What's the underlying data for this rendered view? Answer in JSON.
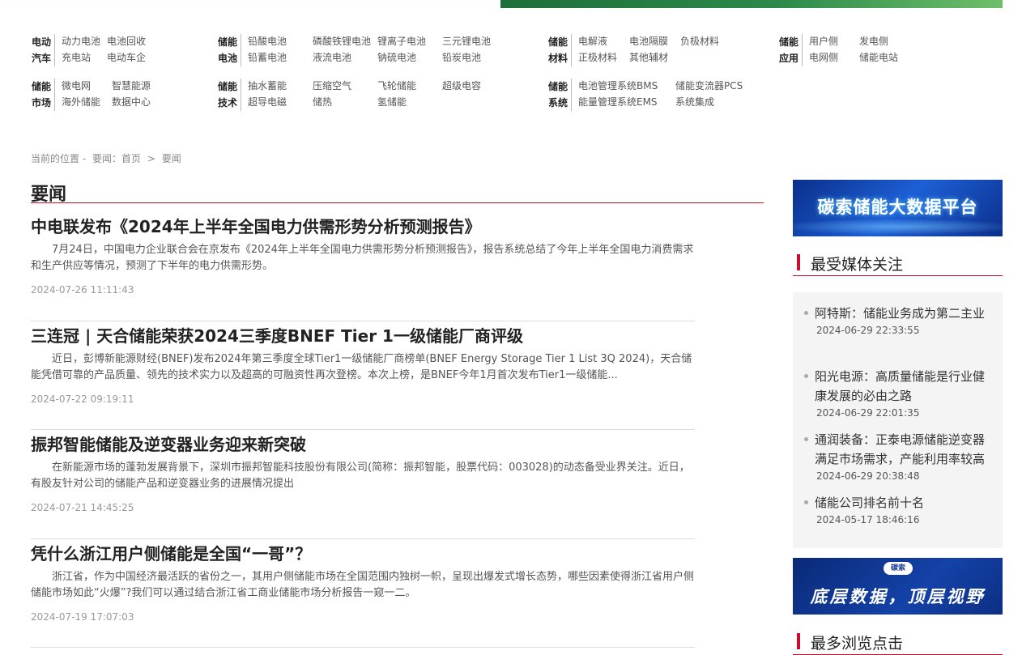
{
  "nav": {
    "groups": [
      {
        "cat": [
          "电动",
          "汽车"
        ],
        "rows": [
          [
            "动力电池",
            "电池回收"
          ],
          [
            "充电站",
            "电动车企"
          ]
        ]
      },
      {
        "cat": [
          "储能",
          "电池"
        ],
        "rows": [
          [
            "铅酸电池",
            "磷酸铁锂电池",
            "锂离子电池",
            "三元锂电池"
          ],
          [
            "铅蓄电池",
            "液流电池",
            "钠硫电池",
            "铅炭电池"
          ]
        ]
      },
      {
        "cat": [
          "储能",
          "材料"
        ],
        "rows": [
          [
            "电解液",
            "电池隔膜",
            "负极材料"
          ],
          [
            "正极材料",
            "其他辅材"
          ]
        ]
      },
      {
        "cat": [
          "储能",
          "应用"
        ],
        "rows": [
          [
            "用户侧",
            "发电侧"
          ],
          [
            "电网侧",
            "储能电站"
          ]
        ]
      },
      {
        "cat": [
          "储能",
          "市场"
        ],
        "rows": [
          [
            "微电网",
            "智慧能源"
          ],
          [
            "海外储能",
            "数据中心"
          ]
        ]
      },
      {
        "cat": [
          "储能",
          "技术"
        ],
        "rows": [
          [
            "抽水蓄能",
            "压缩空气",
            "飞轮储能",
            "超级电容"
          ],
          [
            "超导电磁",
            "储热",
            "氢储能"
          ]
        ]
      },
      {
        "cat": [
          "储能",
          "系统"
        ],
        "rows": [
          [
            "电池管理系统BMS",
            "储能变流器PCS"
          ],
          [
            "能量管理系统EMS",
            "系统集成"
          ]
        ]
      }
    ]
  },
  "breadcrumb": {
    "prefix": "当前的位置 -",
    "items": [
      "要闻：首页",
      ">",
      "要闻"
    ]
  },
  "section_title": "要闻",
  "news": [
    {
      "title": "中电联发布《2024年上半年全国电力供需形势分析预测报告》",
      "summary": "7月24日，中国电力企业联合会在京发布《2024年上半年全国电力供需形势分析预测报告》，报告系统总结了今年上半年全国电力消费需求和生产供应等情况，预测了下半年的电力供需形势。",
      "date": "2024-07-26 11:11:43"
    },
    {
      "title": "三连冠 | 天合储能荣获2024三季度BNEF Tier 1一级储能厂商评级",
      "summary": "近日，彭博新能源财经(BNEF)发布2024年第三季度全球Tier1一级储能厂商榜单(BNEF Energy Storage Tier 1 List 3Q 2024)，天合储能凭借可靠的产品质量、领先的技术实力以及超高的可融资性再次登榜。本次上榜，是BNEF今年1月首次发布Tier1一级储能...",
      "date": "2024-07-22 09:19:11"
    },
    {
      "title": "振邦智能储能及逆变器业务迎来新突破",
      "summary": "在新能源市场的蓬勃发展背景下，深圳市振邦智能科技股份有限公司(简称：振邦智能，股票代码：003028)的动态备受业界关注。近日，有股友针对公司的储能产品和逆变器业务的进展情况提出",
      "date": "2024-07-21 14:45:25"
    },
    {
      "title": "凭什么浙江用户侧储能是全国“一哥”？",
      "summary": "浙江省，作为中国经济最活跃的省份之一，其用户侧储能市场在全国范围内独树一帜，呈现出爆发式增长态势，哪些因素使得浙江省用户侧储能市场如此“火爆”?我们可以通过结合浙江省工商业储能市场分析报告一窥一二。",
      "date": "2024-07-19 17:07:03"
    }
  ],
  "sidebar": {
    "ad1_text": "碳索储能大数据平台",
    "ad2_logo": "碳索",
    "ad2_text": "底层数据，顶层视野",
    "media_title": "最受媒体关注",
    "media_items": [
      {
        "title": "阿特斯：储能业务成为第二主业",
        "date": "2024-06-29 22:33:55"
      },
      {
        "title": "阳光电源：高质量储能是行业健康发展的必由之路",
        "date": "2024-06-29 22:01:35"
      },
      {
        "title": "通润装备：正泰电源储能逆变器满足市场需求，产能利用率较高",
        "date": "2024-06-29 20:38:48"
      },
      {
        "title": "储能公司排名前十名",
        "date": "2024-05-17 18:46:16"
      }
    ],
    "browse_title": "最多浏览点击"
  }
}
